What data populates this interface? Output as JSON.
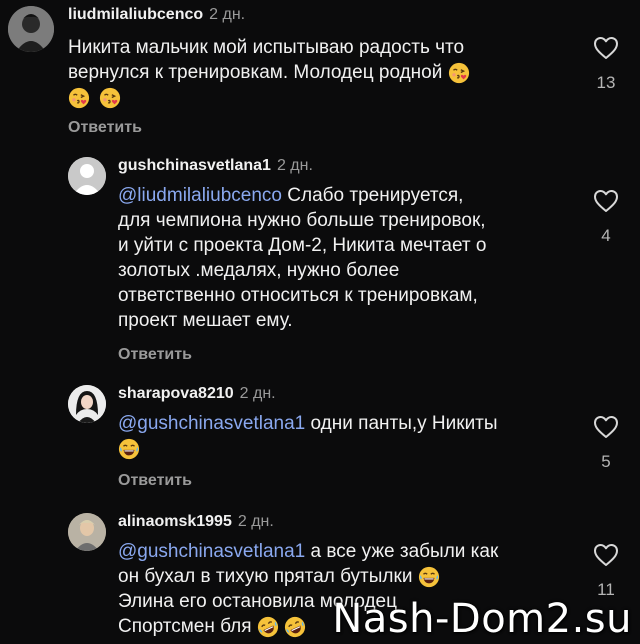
{
  "comments": [
    {
      "username": "liudmilaliubcenco",
      "time": "2 дн.",
      "text_line1": "Никита мальчик мой испытываю радость что",
      "text_line2": "вернулся к тренировкам. Молодец родной",
      "likes": "13",
      "reply_label": "Ответить"
    },
    {
      "username": "gushchinasvetlana1",
      "time": "2 дн.",
      "mention": "@liudmilaliubcenco",
      "text_line1": "Слабо тренируется,",
      "text_line2": "для чемпиона нужно больше тренировок,",
      "text_line3": "и уйти с проекта Дом-2, Никита мечтает о",
      "text_line4": "золотых .медалях, нужно более",
      "text_line5": "ответственно относиться к тренировкам,",
      "text_line6": "проект мешает ему.",
      "likes": "4",
      "reply_label": "Ответить"
    },
    {
      "username": "sharapova8210",
      "time": "2 дн.",
      "mention": "@gushchinasvetlana1",
      "text_line1": "одни панты,у Никиты",
      "likes": "5",
      "reply_label": "Ответить"
    },
    {
      "username": "alinaomsk1995",
      "time": "2 дн.",
      "mention": "@gushchinasvetlana1",
      "text_line1": "а все уже забыли как",
      "text_line2": "он бухал в тихую прятал бутылки",
      "text_line3": "Элина его остановила молодец",
      "text_line4": "Спортсмен бля",
      "likes": "11"
    }
  ],
  "watermark": "Nash-Dom2.su",
  "icons": {
    "like": "heart-outline-icon",
    "kiss_emoji": "face-blowing-kiss-icon",
    "laugh_emoji": "face-with-tears-of-joy-icon",
    "rofl_emoji": "rolling-on-floor-laughing-icon"
  },
  "colors": {
    "background": "#0b0b0c",
    "mention": "#8aa8ef",
    "secondary": "#9a9a9a"
  }
}
